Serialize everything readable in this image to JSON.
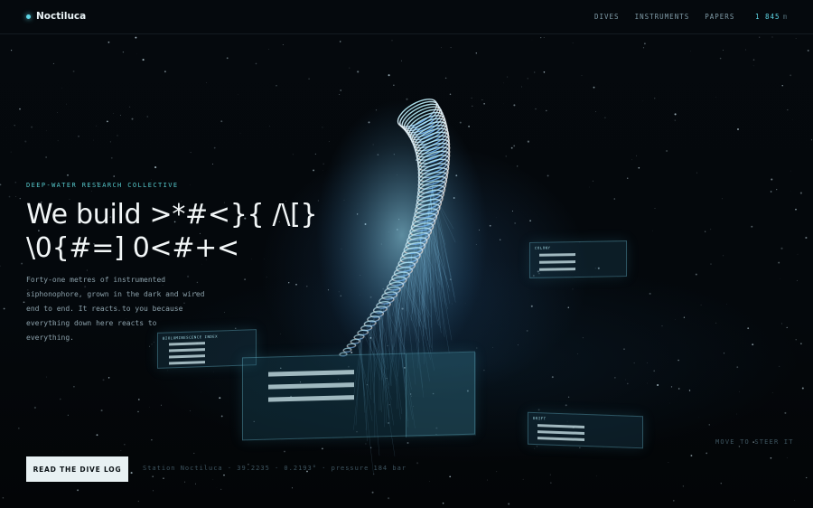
{
  "brand": {
    "name": "Noctiluca",
    "accent": "#5ed6e6"
  },
  "nav": {
    "items": [
      "DIVES",
      "INSTRUMENTS",
      "PAPERS"
    ]
  },
  "depth": {
    "value": "1 845",
    "unit": "m"
  },
  "hero": {
    "eyebrow": "DEEP-WATER RESEARCH COLLECTIVE",
    "headline_line1": "We build >*#<}{ /\\[}",
    "headline_line2": "\\0{#=] 0<#+<",
    "lede": "Forty-one metres of instrumented siphonophore, grown in the dark and wired end to end. It reacts to you because everything down here reacts to everything."
  },
  "cta": {
    "label": "READ THE DIVE LOG"
  },
  "station": {
    "text": "Station Noctiluca · 39.2235 · 0.2193° · pressure 184 bar"
  },
  "hint": {
    "text": "MOVE TO STEER IT"
  },
  "panels": {
    "bioluminescence": {
      "title": "BIOLUMINESCENCE INDEX"
    },
    "colony": {
      "title": "COLONY"
    },
    "drift": {
      "title": "DRIFT"
    }
  }
}
